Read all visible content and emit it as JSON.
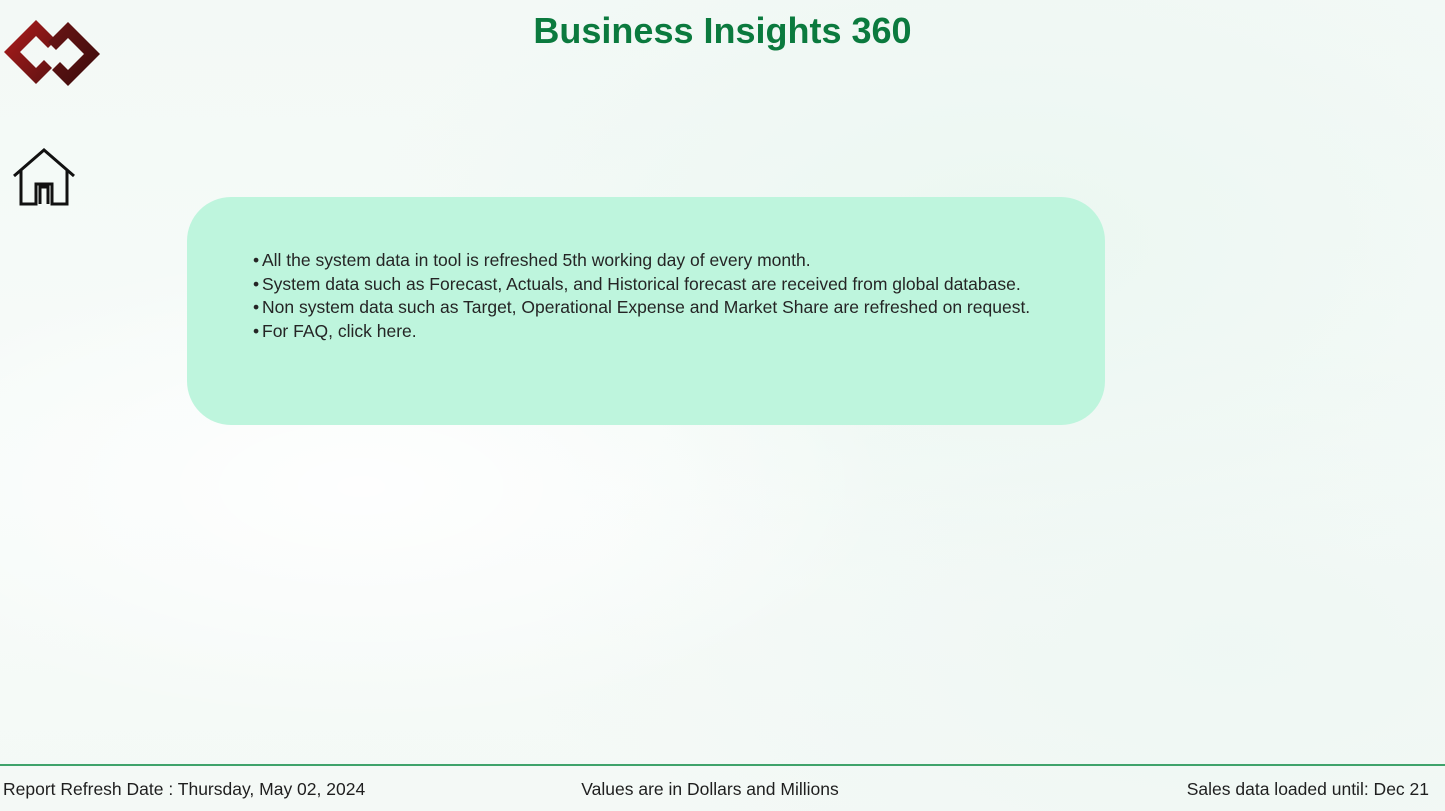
{
  "header": {
    "title": "Business Insights 360",
    "logo_icon": "interlocking-diamond-logo",
    "home_icon": "home-icon"
  },
  "colors": {
    "title": "#0b7a3e",
    "card_background": "#bef5dd",
    "footer_rule": "#3fa36b",
    "logo_dark": "#4a1010",
    "logo_red": "#a11a1a"
  },
  "info": {
    "bullet": "•",
    "items": [
      "All the system data in tool is refreshed 5th working day of every month.",
      "System data such as Forecast, Actuals, and Historical forecast are received from global database.",
      "Non system data such as Target, Operational Expense and Market Share are refreshed on request.",
      "For FAQ, click here."
    ]
  },
  "footer": {
    "refresh_label": "Report Refresh Date :",
    "refresh_date": "Thursday, May 02, 2024",
    "units_note": "Values are in Dollars and Millions",
    "sales_loaded": "Sales data loaded until: Dec 21"
  }
}
